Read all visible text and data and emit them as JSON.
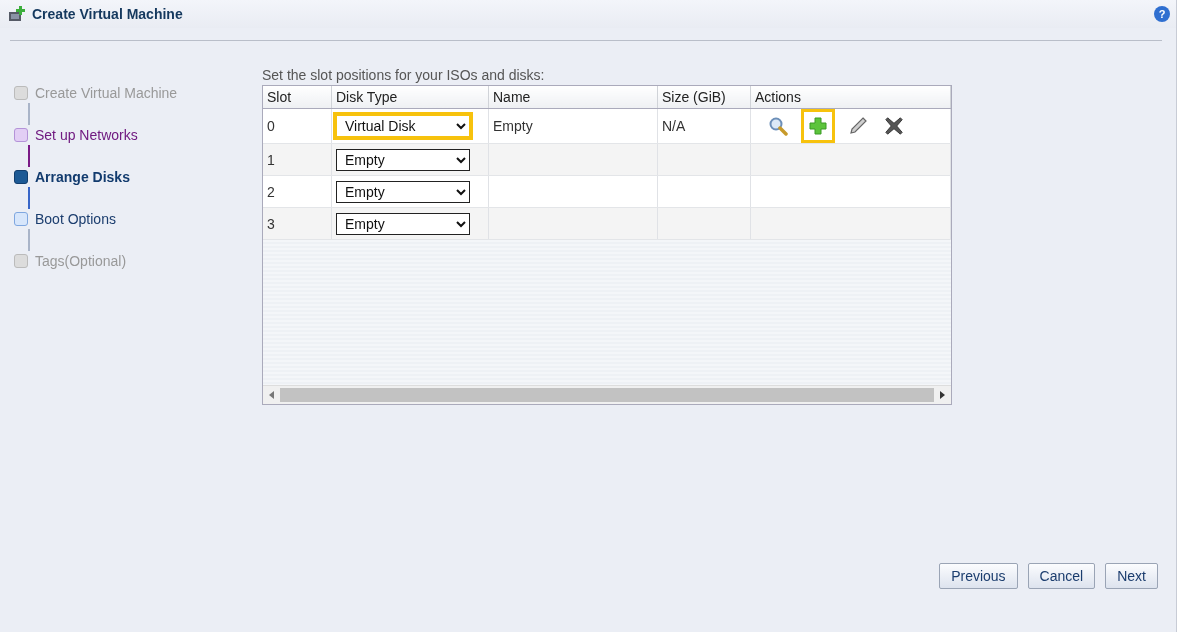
{
  "window": {
    "title": "Create Virtual Machine",
    "help": "?"
  },
  "steps": [
    {
      "label": "Create Virtual Machine",
      "disabled": true,
      "completed": false,
      "selected": false
    },
    {
      "label": "Set up Networks",
      "disabled": false,
      "completed": true,
      "selected": false
    },
    {
      "label": "Arrange Disks",
      "disabled": false,
      "completed": false,
      "selected": true
    },
    {
      "label": "Boot Options",
      "disabled": false,
      "completed": false,
      "selected": false
    },
    {
      "label": "Tags(Optional)",
      "disabled": true,
      "completed": false,
      "selected": false
    }
  ],
  "instruction": "Set the slot positions for your ISOs and disks:",
  "table": {
    "columns": [
      "Slot",
      "Disk Type",
      "Name",
      "Size (GiB)",
      "Actions"
    ],
    "rows": [
      {
        "slot": "0",
        "disk_type": "Virtual Disk",
        "disk_type_highlighted": true,
        "name": "Empty",
        "size": "N/A",
        "actions": [
          {
            "kind": "search",
            "highlighted": false
          },
          {
            "kind": "add",
            "highlighted": true
          },
          {
            "kind": "edit",
            "highlighted": false
          },
          {
            "kind": "delete",
            "highlighted": false
          }
        ]
      },
      {
        "slot": "1",
        "disk_type": "Empty",
        "disk_type_highlighted": false
      },
      {
        "slot": "2",
        "disk_type": "Empty",
        "disk_type_highlighted": false
      },
      {
        "slot": "3",
        "disk_type": "Empty",
        "disk_type_highlighted": false
      }
    ]
  },
  "buttons": [
    {
      "label": "Previous"
    },
    {
      "label": "Cancel"
    },
    {
      "label": "Next"
    }
  ]
}
